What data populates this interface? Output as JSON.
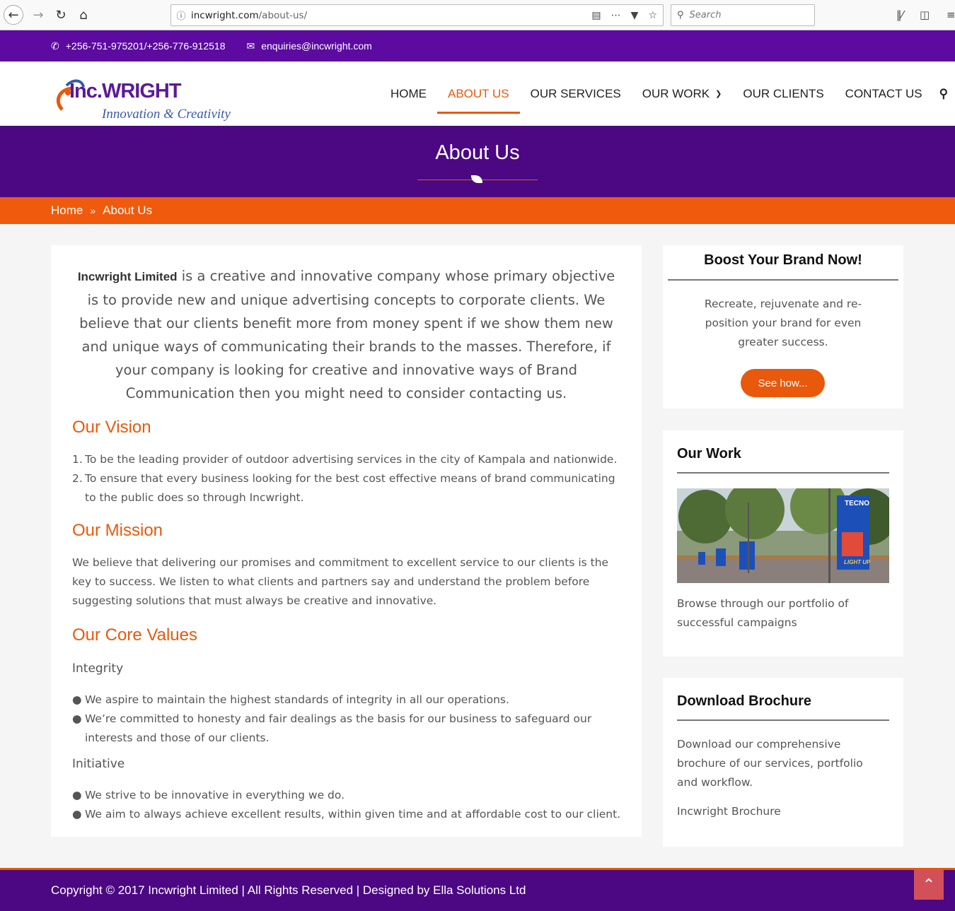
{
  "browser": {
    "url_host": "incwright.com",
    "url_path": "/about-us/",
    "search_placeholder": "Search"
  },
  "topbar": {
    "phone": "+256-751-975201/+256-776-912518",
    "email": "enquiries@incwright.com"
  },
  "logo": {
    "brand": "Inc.WRIGHT",
    "tagline": "Innovation & Creativity"
  },
  "menu": {
    "home": "HOME",
    "about": "ABOUT US",
    "services": "OUR SERVICES",
    "work": "OUR WORK",
    "clients": "OUR CLIENTS",
    "contact": "CONTACT US"
  },
  "banner": {
    "title": "About Us"
  },
  "breadcrumb": {
    "home": "Home",
    "current": "About Us"
  },
  "content": {
    "intro_company": "Incwright Limited",
    "intro_text": " is a creative and innovative company whose primary objective is to provide new and unique advertising concepts to corporate clients. We believe that our clients benefit more from money spent if we show them new and unique ways of communicating their brands to the masses. Therefore, if your company is looking for creative and innovative ways of Brand Communication then you might need to consider contacting us.",
    "vision_title": "Our Vision",
    "vision": [
      "To be the leading provider of outdoor advertising services in the city of Kampala and nationwide.",
      "To ensure that every business looking for the best cost effective means of brand communicating to the public does so through Incwright."
    ],
    "mission_title": "Our Mission",
    "mission": "We believe that delivering our promises and commitment to excellent service to our clients is the key to success. We listen to what clients and partners say and understand the problem before suggesting solutions that must always be creative and innovative.",
    "values_title": "Our Core Values",
    "integrity_title": "Integrity",
    "integrity": [
      "We aspire to maintain the highest standards of integrity in all our operations.",
      "We’re committed to honesty and fair dealings as the basis for our business to safeguard our interests and those of our clients."
    ],
    "initiative_title": "Initiative",
    "initiative": [
      "We strive to be innovative in everything we do.",
      "We aim to always achieve excellent results, within given time and at affordable cost to our client."
    ]
  },
  "sidebar": {
    "boost_title": "Boost Your Brand Now!",
    "boost_text": "Recreate, rejuvenate and re-position your brand for even greater success.",
    "boost_button": "See how...",
    "work_title": "Our Work",
    "work_text": "Browse through our portfolio of successful campaigns",
    "billboard_brand": "TECNO",
    "billboard_slogan": "LIGHT UP",
    "brochure_title": "Download Brochure",
    "brochure_text": "Download our comprehensive brochure of our services, portfolio and workflow.",
    "brochure_link": "Incwright Brochure"
  },
  "footer": {
    "text": "Copyright © 2017 Incwright Limited | All Rights Reserved | Designed by Ella Solutions Ltd"
  },
  "colors": {
    "purple": "#4b0882",
    "orange": "#ef5a0c"
  }
}
